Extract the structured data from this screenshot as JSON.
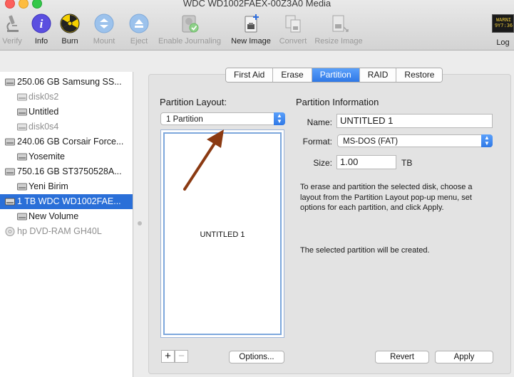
{
  "window": {
    "title": "WDC WD1002FAEX-00Z3A0 Media"
  },
  "toolbar": {
    "items": [
      {
        "label": "Verify",
        "icon": "microscope-icon",
        "enabled": false
      },
      {
        "label": "Info",
        "icon": "info-icon",
        "enabled": true
      },
      {
        "label": "Burn",
        "icon": "burn-icon",
        "enabled": true
      },
      {
        "label": "Mount",
        "icon": "mount-icon",
        "enabled": false
      },
      {
        "label": "Eject",
        "icon": "eject-icon",
        "enabled": false
      },
      {
        "label": "Enable Journaling",
        "icon": "journaling-icon",
        "enabled": false
      },
      {
        "label": "New Image",
        "icon": "new-image-icon",
        "enabled": true
      },
      {
        "label": "Convert",
        "icon": "convert-icon",
        "enabled": false
      },
      {
        "label": "Resize Image",
        "icon": "resize-image-icon",
        "enabled": false
      },
      {
        "label": "Log",
        "icon": "log-icon",
        "enabled": true
      }
    ],
    "log_badge": "WARNI\n9Y7:36"
  },
  "sidebar": {
    "items": [
      {
        "label": "250.06 GB Samsung SS...",
        "type": "drive",
        "state": "normal"
      },
      {
        "label": "disk0s2",
        "type": "volume",
        "state": "dim"
      },
      {
        "label": "Untitled",
        "type": "volume",
        "state": "normal"
      },
      {
        "label": "disk0s4",
        "type": "volume",
        "state": "dim"
      },
      {
        "label": "240.06 GB Corsair Force...",
        "type": "drive",
        "state": "normal"
      },
      {
        "label": "Yosemite",
        "type": "volume",
        "state": "normal"
      },
      {
        "label": "750.16 GB ST3750528A...",
        "type": "drive",
        "state": "normal"
      },
      {
        "label": "Yeni Birim",
        "type": "volume",
        "state": "normal"
      },
      {
        "label": "1 TB WDC WD1002FAE...",
        "type": "drive",
        "state": "selected"
      },
      {
        "label": "New Volume",
        "type": "volume",
        "state": "normal"
      },
      {
        "label": "hp DVD-RAM GH40L",
        "type": "optical",
        "state": "dim"
      }
    ]
  },
  "tabs": [
    "First Aid",
    "Erase",
    "Partition",
    "RAID",
    "Restore"
  ],
  "active_tab": "Partition",
  "partition": {
    "layout_heading": "Partition Layout:",
    "layout_value": "1 Partition",
    "partition_label": "UNTITLED 1",
    "info_heading": "Partition Information",
    "name_label": "Name:",
    "name_value": "UNTITLED 1",
    "format_label": "Format:",
    "format_value": "MS-DOS (FAT)",
    "size_label": "Size:",
    "size_value": "1.00",
    "size_unit": "TB",
    "description": "To erase and partition the selected disk, choose a layout from the Partition Layout pop-up menu, set options for each partition, and click Apply.",
    "status": "The selected partition will be created.",
    "add_label": "+",
    "remove_label": "−",
    "options_label": "Options...",
    "revert_label": "Revert",
    "apply_label": "Apply"
  },
  "colors": {
    "accent": "#2f78e6",
    "selection": "#2a6fd8",
    "annotation_arrow": "#8b3a12"
  }
}
